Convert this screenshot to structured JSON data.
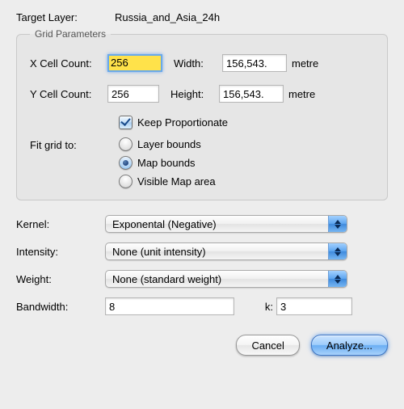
{
  "target": {
    "label": "Target Layer:",
    "value": "Russia_and_Asia_24h"
  },
  "grid": {
    "legend": "Grid Parameters",
    "x_label": "X Cell Count:",
    "x_value": "256",
    "width_label": "Width:",
    "width_value": "156,543.",
    "width_unit": "metre",
    "y_label": "Y Cell Count:",
    "y_value": "256",
    "height_label": "Height:",
    "height_value": "156,543.",
    "height_unit": "metre",
    "keep_prop_label": "Keep Proportionate",
    "keep_prop_checked": true,
    "fit_label": "Fit grid to:",
    "fit_options": {
      "layer": "Layer bounds",
      "map": "Map bounds",
      "visible": "Visible Map area"
    },
    "fit_selected": "map"
  },
  "params": {
    "kernel_label": "Kernel:",
    "kernel_value": "Exponental (Negative)",
    "intensity_label": "Intensity:",
    "intensity_value": "None (unit intensity)",
    "weight_label": "Weight:",
    "weight_value": "None (standard weight)",
    "bandwidth_label": "Bandwidth:",
    "bandwidth_value": "8",
    "k_label": "k:",
    "k_value": "3"
  },
  "buttons": {
    "cancel": "Cancel",
    "analyze": "Analyze..."
  }
}
